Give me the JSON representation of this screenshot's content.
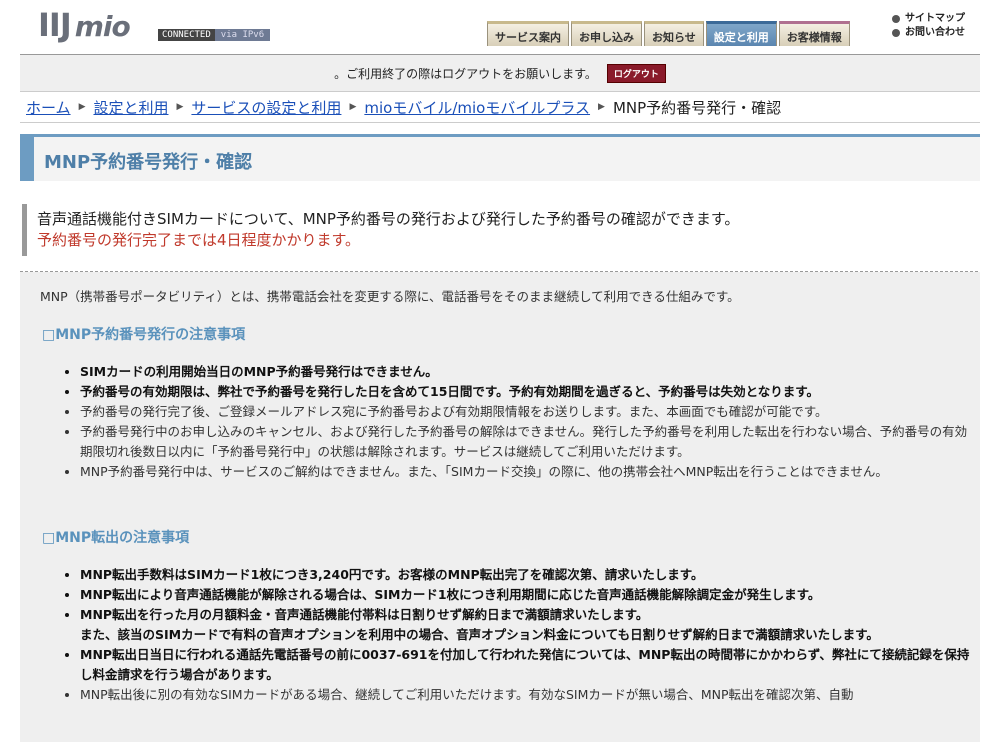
{
  "header": {
    "logo_main": "IIJ",
    "logo_sub": "mio",
    "connection_status": "CONNECTED",
    "connection_type": "via IPv6",
    "tabs": [
      {
        "label": "サービス案内"
      },
      {
        "label": "お申し込み"
      },
      {
        "label": "お知らせ"
      },
      {
        "label": "設定と利用"
      },
      {
        "label": "お客様情報"
      }
    ],
    "util_links": [
      {
        "label": "サイトマップ"
      },
      {
        "label": "お問い合わせ"
      }
    ]
  },
  "notice": {
    "text": "。ご利用終了の際はログアウトをお願いします。",
    "logout_label": "ログアウト"
  },
  "breadcrumb": {
    "items": [
      "ホーム",
      "設定と利用",
      "サービスの設定と利用",
      "mioモバイル/mioモバイルプラス"
    ],
    "current": "MNP予約番号発行・確認"
  },
  "page_title": "MNP予約番号発行・確認",
  "lead": {
    "line1": "音声通話機能付きSIMカードについて、MNP予約番号の発行および発行した予約番号の確認ができます。",
    "line2": "予約番号の発行完了までは4日程度かかります。"
  },
  "intro": "MNP（携帯番号ポータビリティ）とは、携帯電話会社を変更する際に、電話番号をそのまま継続して利用できる仕組みです。",
  "section1": {
    "title": "□MNP予約番号発行の注意事項",
    "items": [
      "SIMカードの利用開始当日のMNP予約番号発行はできません。",
      "予約番号の有効期限は、弊社で予約番号を発行した日を含めて15日間です。予約有効期間を過ぎると、予約番号は失効となります。",
      "予約番号の発行完了後、ご登録メールアドレス宛に予約番号および有効期限情報をお送りします。また、本画面でも確認が可能です。",
      "予約番号発行中のお申し込みのキャンセル、および発行した予約番号の解除はできません。発行した予約番号を利用した転出を行わない場合、予約番号の有効期限切れ後数日以内に「予約番号発行中」の状態は解除されます。サービスは継続してご利用いただけます。",
      "MNP予約番号発行中は、サービスのご解約はできません。また、「SIMカード交換」の際に、他の携帯会社へMNP転出を行うことはできません。"
    ]
  },
  "section2": {
    "title": "□MNP転出の注意事項",
    "items": [
      "MNP転出手数料はSIMカード1枚につき3,240円です。お客様のMNP転出完了を確認次第、請求いたします。",
      "MNP転出により音声通話機能が解除される場合は、SIMカード1枚につき利用期間に応じた音声通話機能解除調定金が発生します。",
      "MNP転出を行った月の月額料金・音声通話機能付帯料は日割りせず解約日まで満額請求いたします。",
      "また、該当のSIMカードで有料の音声オプションを利用中の場合、音声オプション料金についても日割りせず解約日まで満額請求いたします。",
      "MNP転出日当日に行われる通話先電話番号の前に0037-691を付加して行われた発信については、MNP転出の時間帯にかかわらず、弊社にて接続記録を保持し料金請求を行う場合があります。",
      "MNP転出後に別の有効なSIMカードがある場合、継続してご利用いただけます。有効なSIMカードが無い場合、MNP転出を確認次第、自動"
    ]
  }
}
